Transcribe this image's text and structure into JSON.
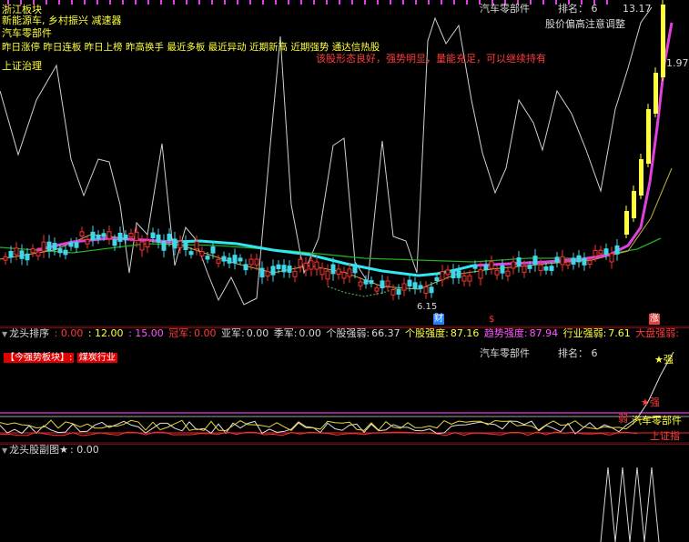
{
  "main": {
    "info_lines": [
      "浙江板块",
      "新能源车, 乡村振兴 减速器",
      "汽车零部件",
      "昨日涨停 昨日连板 昨日上榜 昨高换手 最近多板 最近异动 近期新高 近期强势 通达信热股",
      "上证治理"
    ],
    "industry": "汽车零部件",
    "rank_label": "排名：",
    "rank_value": "6",
    "alert": "股价偏高注意调整",
    "comment": "该股形态良好，强势明显，量能充足，可以继续持有",
    "price_high": "13.17",
    "price_right": "1.97",
    "price_low": "6.15",
    "marker_cai": "财",
    "marker_dollar": "$",
    "marker_zhang": "涨",
    "colors": {
      "up": "#ff3030",
      "down": "#40d8e8",
      "ma_cyan": "#30e8f0",
      "ma_magenta": "#e040e0",
      "ma_green": "#20b020",
      "line_white": "#d0d0d0",
      "yellow": "#ffff3c"
    }
  },
  "middle": {
    "indicator_name": "龙头排序",
    "val1": ": 0.00",
    "val2": ": 12.00",
    "val3": ": 15.00",
    "champ_label": "冠军:",
    "champ_value": "0.00",
    "runner_label": "亚军:",
    "runner_value": "0.00",
    "third_label": "季军:",
    "third_value": "0.00",
    "stock_weak_label": "个股强弱:",
    "stock_weak_value": "66.37",
    "stock_strength_label": "个股强度:",
    "stock_strength_value": "87.16",
    "trend_label": "趋势强度:",
    "trend_value": "87.94",
    "industry_label": "行业强弱:",
    "industry_value": "7.61",
    "market_label": "大盘强弱:",
    "sector_label": "【今强势板块】:",
    "sector_value": "煤炭行业",
    "industry": "汽车零部件",
    "rank_label": "排名：",
    "rank_value": "6",
    "lbl_star_strong": "★强",
    "lbl_strong": "★强",
    "lbl_weak": "弱",
    "lbl_industry": "汽车零部件",
    "lbl_sh": "上证指"
  },
  "sub": {
    "indicator_name": "龙头股副图★",
    "value": ": 0.00"
  }
}
